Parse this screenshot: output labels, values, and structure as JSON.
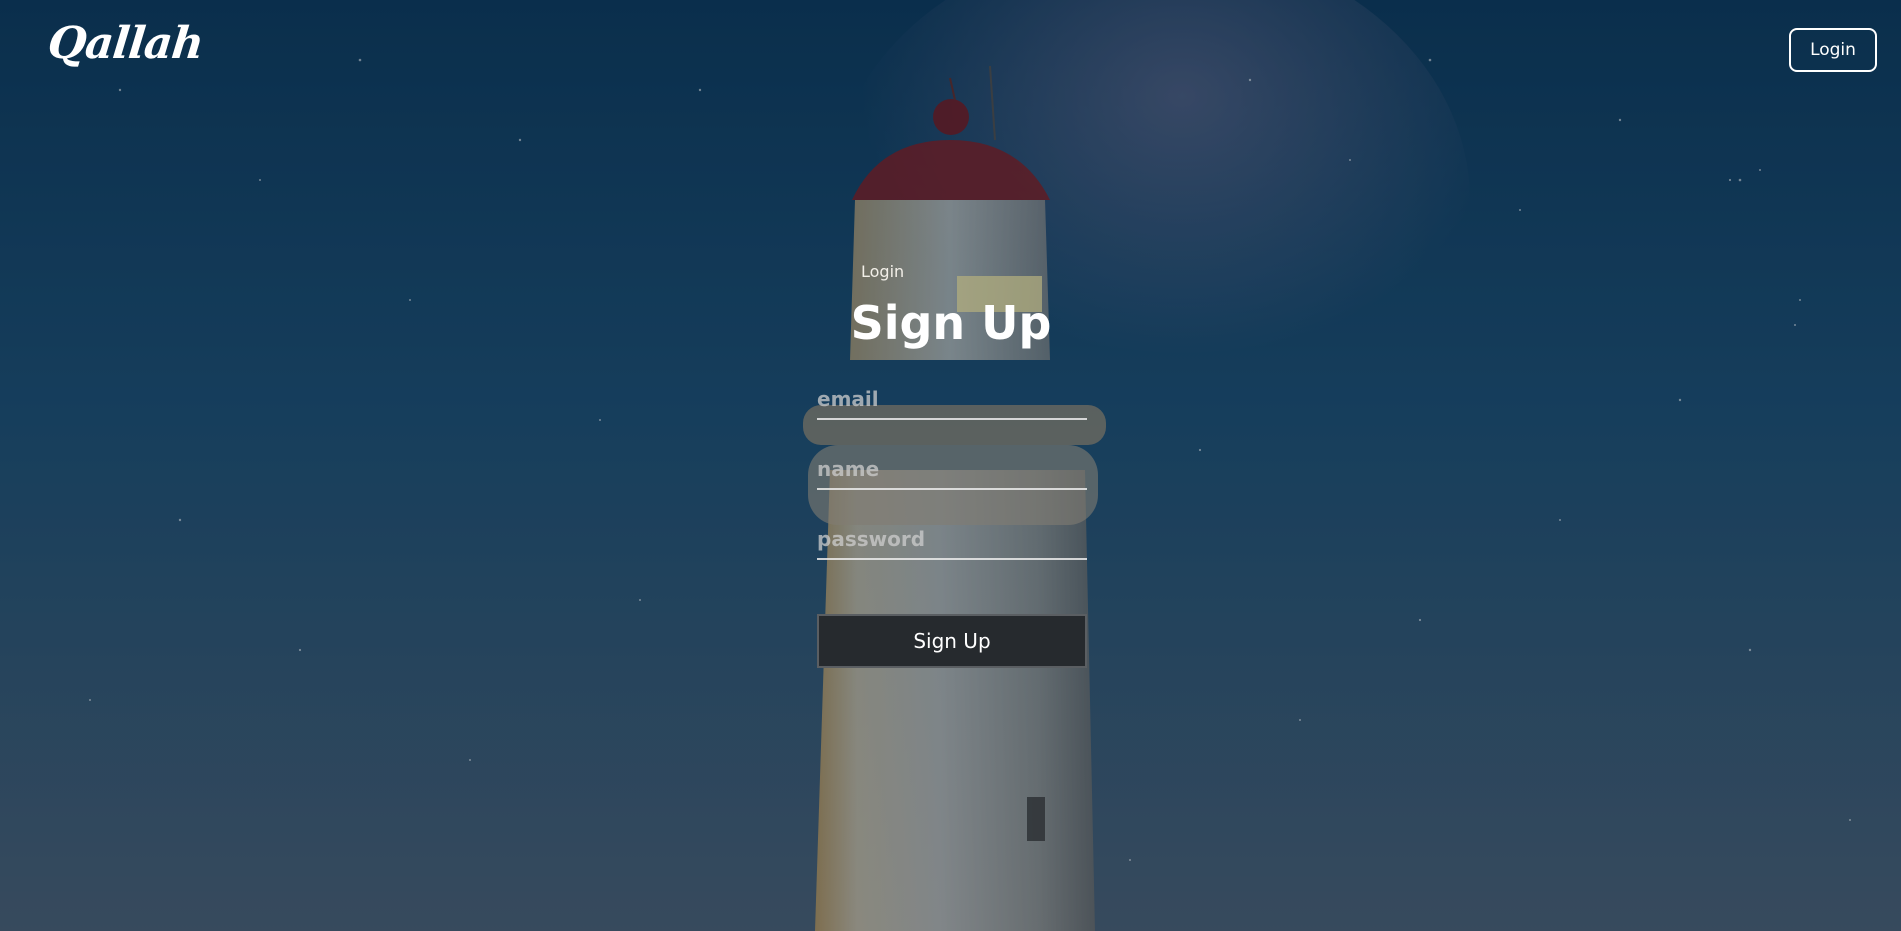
{
  "brand": {
    "logo_text": "Qallah"
  },
  "header": {
    "login_label": "Login"
  },
  "form": {
    "switch_label": "Login",
    "title": "Sign Up",
    "email_placeholder": "email",
    "name_placeholder": "name",
    "password_placeholder": "password",
    "submit_label": "Sign Up"
  }
}
